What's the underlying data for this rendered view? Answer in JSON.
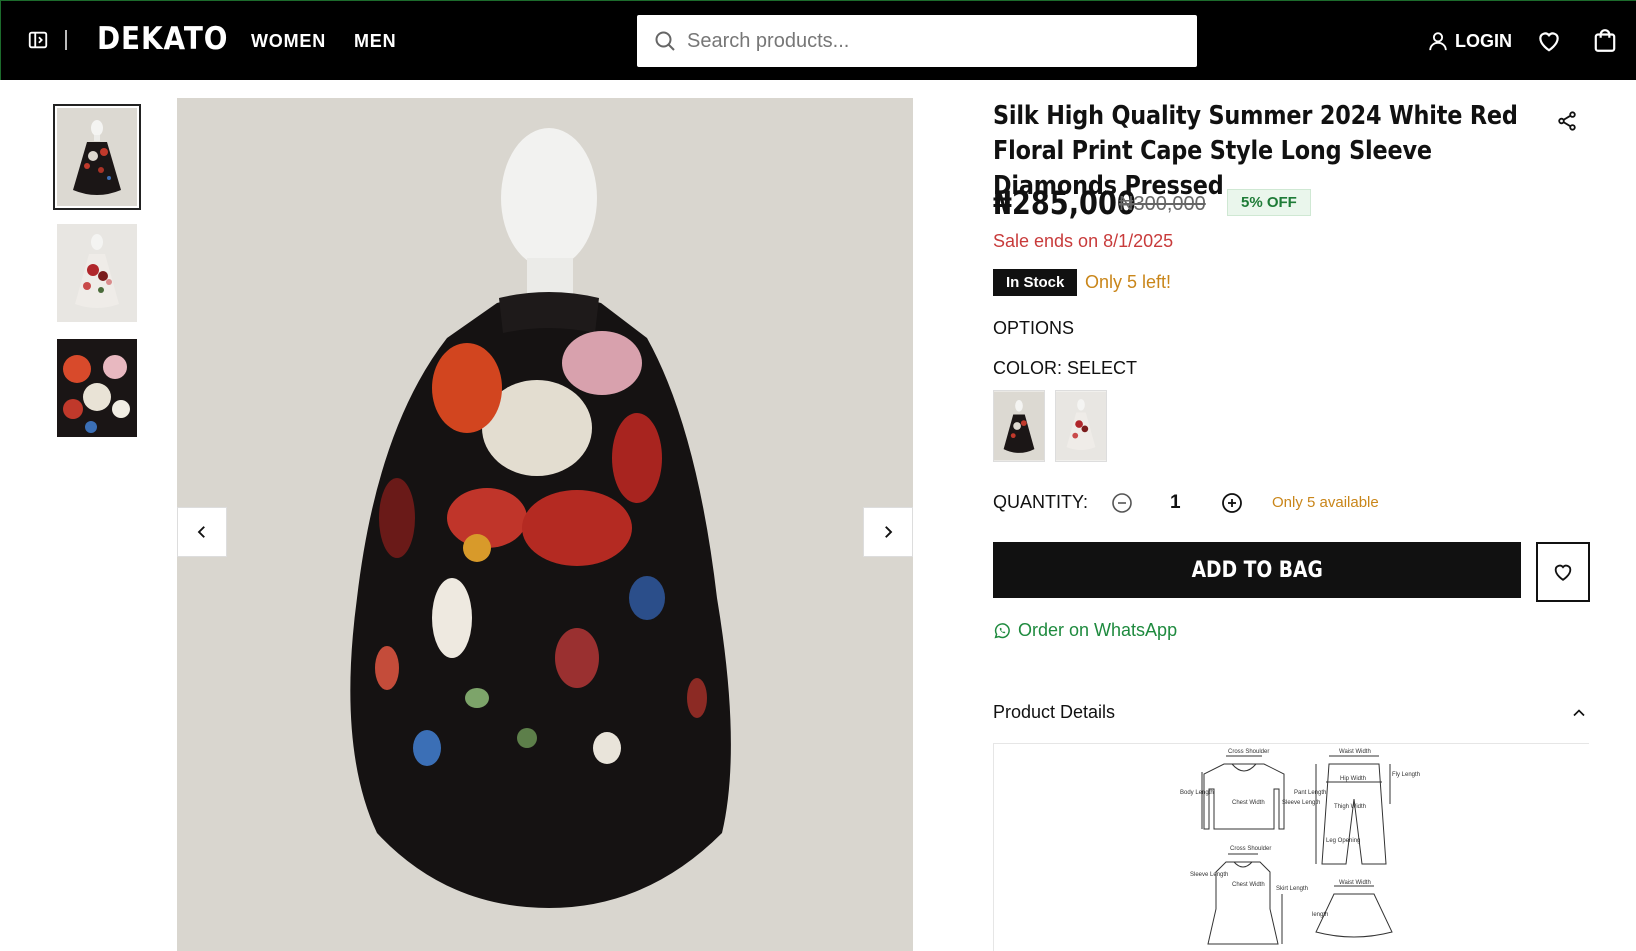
{
  "header": {
    "brand": "DEKATO",
    "nav": [
      "WOMEN",
      "MEN"
    ],
    "search_placeholder": "Search products...",
    "login_label": "LOGIN"
  },
  "product": {
    "title": "Silk High Quality Summer 2024 White Red Floral Print Cape Style Long Sleeve Diamonds Pressed",
    "price": "₦285,000",
    "old_price": "₦300,000",
    "discount": "5% OFF",
    "sale_ends": "Sale ends on 8/1/2025",
    "stock_status": "In Stock",
    "stock_left": "Only 5 left!",
    "options_label": "OPTIONS",
    "color_label": "COLOR: SELECT",
    "quantity_label": "QUANTITY:",
    "quantity": "1",
    "quantity_note": "Only 5 available",
    "add_to_bag": "ADD TO BAG",
    "whatsapp": "Order on WhatsApp",
    "details_label": "Product Details"
  },
  "size_chart_labels": {
    "cross_shoulder": "Cross Shoulder",
    "body_length": "Body Length",
    "chest_width": "Chest Width",
    "sleeve_length": "Sleeve Length",
    "waist_width": "Waist Width",
    "pant_length": "Pant Length",
    "hip_width": "Hip Width",
    "fly_length": "Fly Length",
    "thigh_width": "Thigh Width",
    "leg_opening": "Leg Opening",
    "skirt_length": "Skirt Length",
    "length": "length"
  },
  "gallery": {
    "thumbnail_count": 3,
    "active_index": 0
  },
  "colors": {
    "header_bg": "#000000",
    "sale_red": "#c83b3b",
    "stock_orange": "#c9861a",
    "whatsapp_green": "#1e8a3e",
    "discount_green": "#1e7b37",
    "image_bg": "#d9d6cf"
  },
  "icons": [
    "sidebar-toggle-icon",
    "search-icon",
    "user-icon",
    "heart-icon",
    "shopping-bag-icon",
    "share-icon",
    "chevron-left-icon",
    "chevron-right-icon",
    "minus-circle-icon",
    "plus-circle-icon",
    "whatsapp-icon",
    "chevron-up-icon"
  ]
}
